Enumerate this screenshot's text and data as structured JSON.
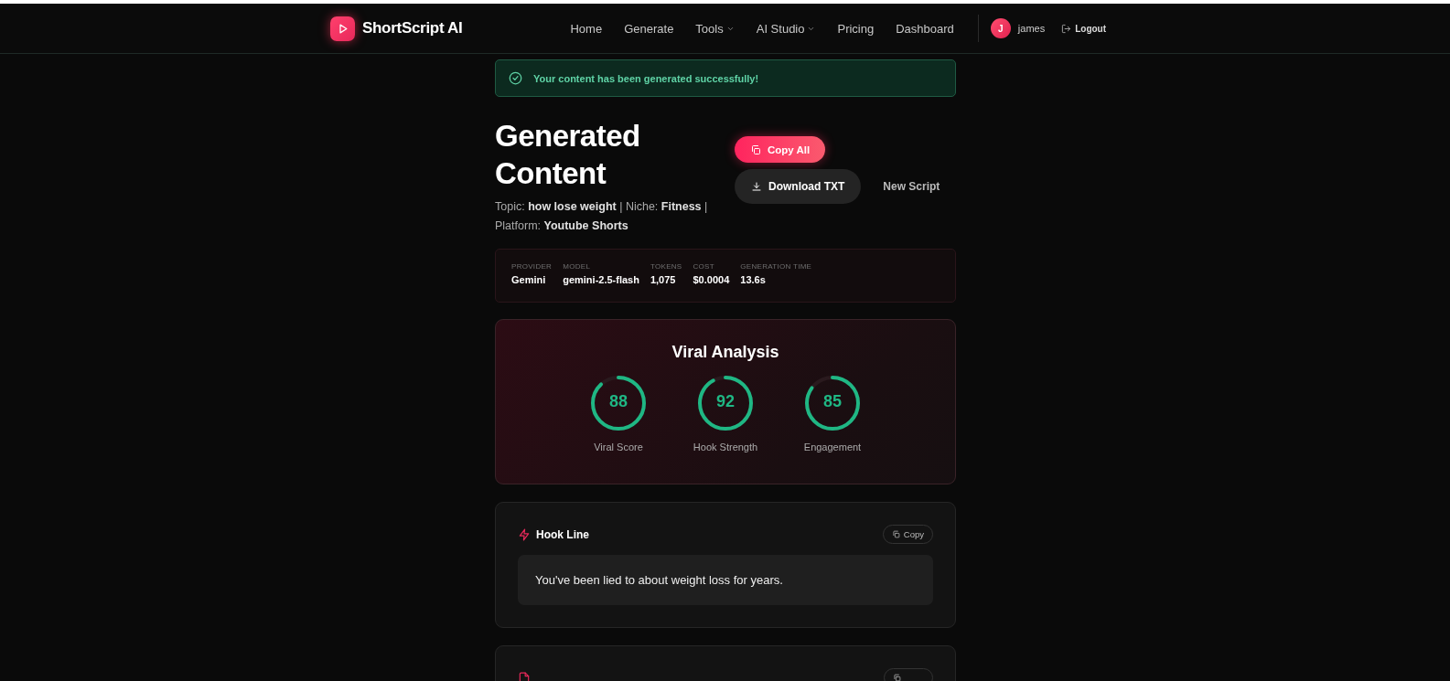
{
  "brand": {
    "name": "ShortScript AI"
  },
  "nav": [
    {
      "label": "Home",
      "dropdown": false
    },
    {
      "label": "Generate",
      "dropdown": false
    },
    {
      "label": "Tools",
      "dropdown": true
    },
    {
      "label": "AI Studio",
      "dropdown": true
    },
    {
      "label": "Pricing",
      "dropdown": false
    },
    {
      "label": "Dashboard",
      "dropdown": false
    }
  ],
  "user": {
    "initial": "J",
    "name": "james",
    "logout": "Logout"
  },
  "alert": {
    "message": "Your content has been generated successfully!"
  },
  "header": {
    "title": "Generated Content",
    "meta": "Topic: **how lose weight** | Niche: **Fitness** |",
    "meta_2": "Platform: **Youtube Shorts**"
  },
  "actions": [
    {
      "kind": "primary",
      "label": "Copy All"
    },
    {
      "kind": "secondary",
      "label": "Download TXT"
    },
    {
      "kind": "link",
      "label": "New Script"
    }
  ],
  "stats": [
    {
      "label": "PROVIDER",
      "value": "Gemini"
    },
    {
      "label": "MODEL",
      "value": "gemini-2.5-flash"
    },
    {
      "label": "TOKENS",
      "value": "1,075"
    },
    {
      "label": "COST",
      "value": "$0.0004"
    },
    {
      "label": "GENERATION TIME",
      "value": "13.6s"
    }
  ],
  "analysis": {
    "title": "Viral Analysis",
    "scores": [
      {
        "score": "88",
        "label": "Viral Score"
      },
      {
        "score": "92",
        "label": "Hook Strength"
      },
      {
        "score": "85",
        "label": "Engagement"
      }
    ]
  },
  "sections": [
    {
      "kind": "hook",
      "title": "Hook Line",
      "copy": "Copy",
      "body": "You've been lied to about weight loss for years."
    },
    {
      "kind": "script"
    }
  ]
}
